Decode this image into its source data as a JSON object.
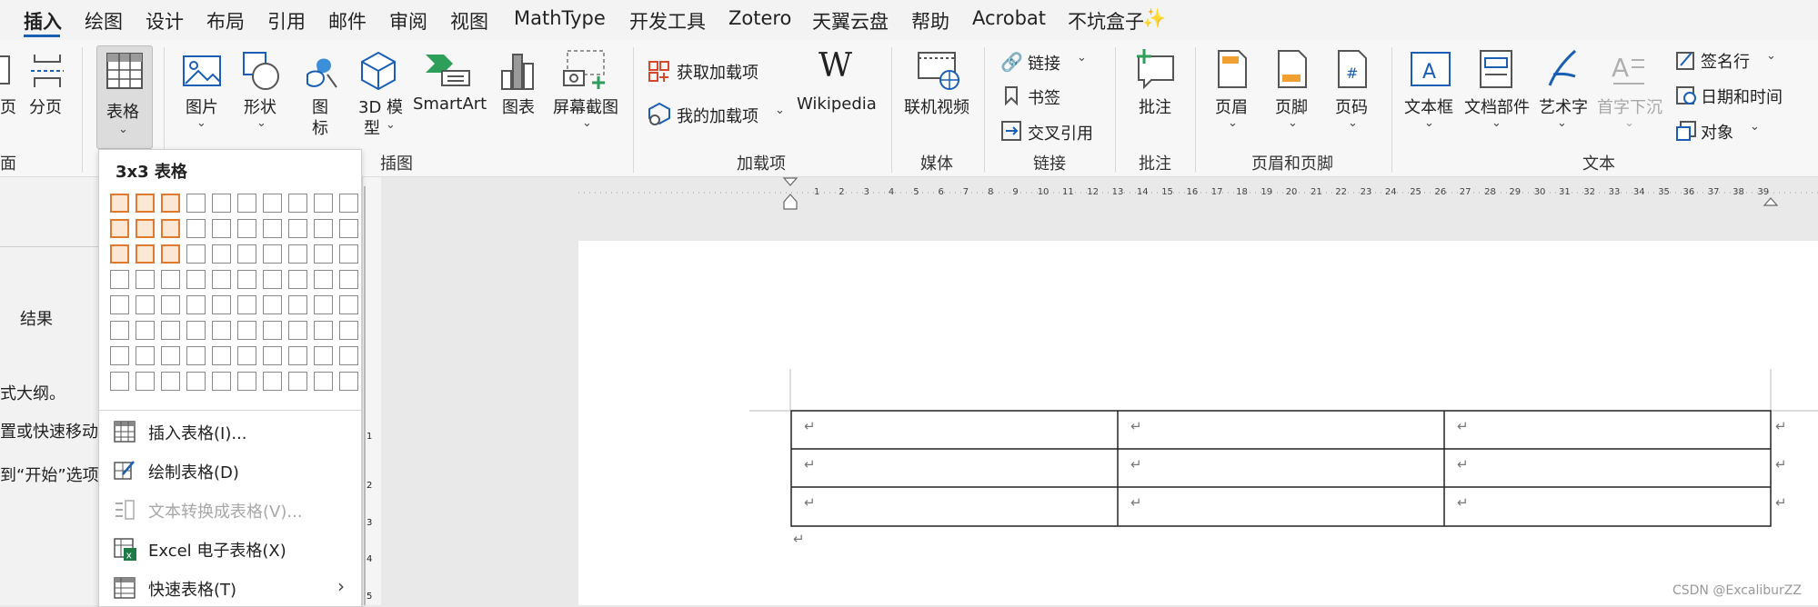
{
  "menu_tabs": [
    "插入",
    "绘图",
    "设计",
    "布局",
    "引用",
    "邮件",
    "审阅",
    "视图",
    "MathType",
    "开发工具",
    "Zotero",
    "天翼云盘",
    "帮助",
    "Acrobat",
    "不坑盒子"
  ],
  "active_tab": "插入",
  "ribbon": {
    "page_break_partial": "页",
    "page_break": "分页",
    "table": "表格",
    "picture": "图片",
    "shapes": "形状",
    "icons_line1": "图",
    "icons_line2": "标",
    "model_line1": "3D 模",
    "model_line2": "型",
    "smartart": "SmartArt",
    "chart": "图表",
    "screenshot": "屏幕截图",
    "get_addins": "获取加载项",
    "my_addins": "我的加载项",
    "wikipedia_logo": "W",
    "wikipedia": "Wikipedia",
    "online_video": "联机视频",
    "link": "链接",
    "bookmark": "书签",
    "cross_reference": "交叉引用",
    "comment": "批注",
    "header": "页眉",
    "footer": "页脚",
    "page_number": "页码",
    "text_box": "文本框",
    "quick_parts": "文档部件",
    "wordart": "艺术字",
    "drop_cap": "首字下沉",
    "signature_line": "签名行",
    "date_time": "日期和时间",
    "object": "对象"
  },
  "groups": {
    "pages_partial": "面",
    "illustrations": "插图",
    "addins": "加载项",
    "media": "媒体",
    "links": "链接",
    "comments": "批注",
    "header_footer": "页眉和页脚",
    "text": "文本"
  },
  "left_pane": {
    "results_tab": "结果",
    "line1": "式大纲。",
    "line2": "置或快速移动",
    "line3": "到“开始”选项"
  },
  "dropdown": {
    "title": "3x3 表格",
    "grid_cols": 10,
    "grid_rows": 8,
    "selected_cols": 3,
    "selected_rows": 3,
    "items": [
      {
        "label": "插入表格(I)...",
        "enabled": true
      },
      {
        "label": "绘制表格(D)",
        "enabled": true
      },
      {
        "label": "文本转换成表格(V)...",
        "enabled": false
      },
      {
        "label": "Excel 电子表格(X)",
        "enabled": true
      },
      {
        "label": "快速表格(T)",
        "enabled": true,
        "submenu": true
      }
    ]
  },
  "ruler_numbers": [
    "1",
    "2",
    "3",
    "4",
    "5",
    "6",
    "7",
    "8",
    "9",
    "10",
    "11",
    "12",
    "13",
    "14",
    "15",
    "16",
    "17",
    "18",
    "19",
    "20",
    "21",
    "22",
    "23",
    "24",
    "25",
    "26",
    "27",
    "28",
    "29",
    "30",
    "31",
    "32",
    "33",
    "34",
    "35",
    "36",
    "37",
    "38",
    "39"
  ],
  "vruler_numbers": [
    "1",
    "2",
    "3",
    "4",
    "5"
  ],
  "document": {
    "cell_mark": "↵",
    "rows": 3,
    "cols": 3
  },
  "watermark": "CSDN @ExcaliburZZ",
  "colors": {
    "accent": "#1a5fb4",
    "selection": "#e07a2e"
  }
}
